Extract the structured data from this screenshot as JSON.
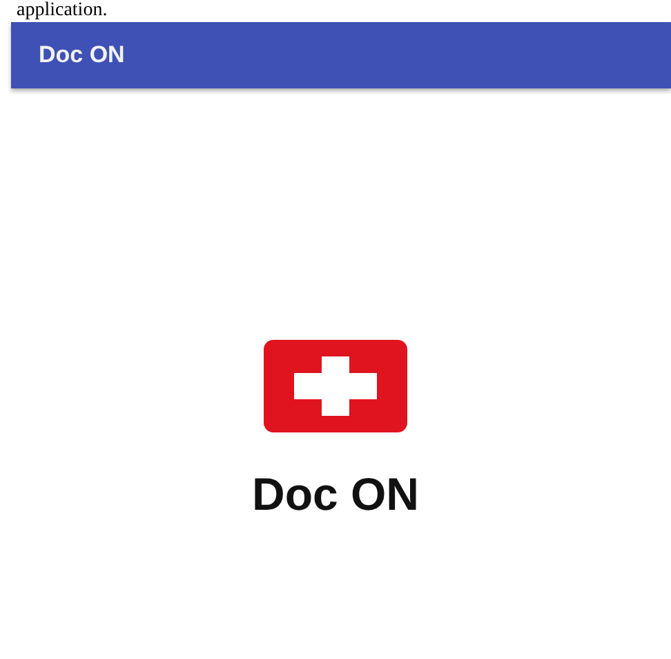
{
  "document_text": "application.",
  "app_bar": {
    "title": "Doc ON"
  },
  "splash": {
    "app_name": "Doc ON"
  }
}
